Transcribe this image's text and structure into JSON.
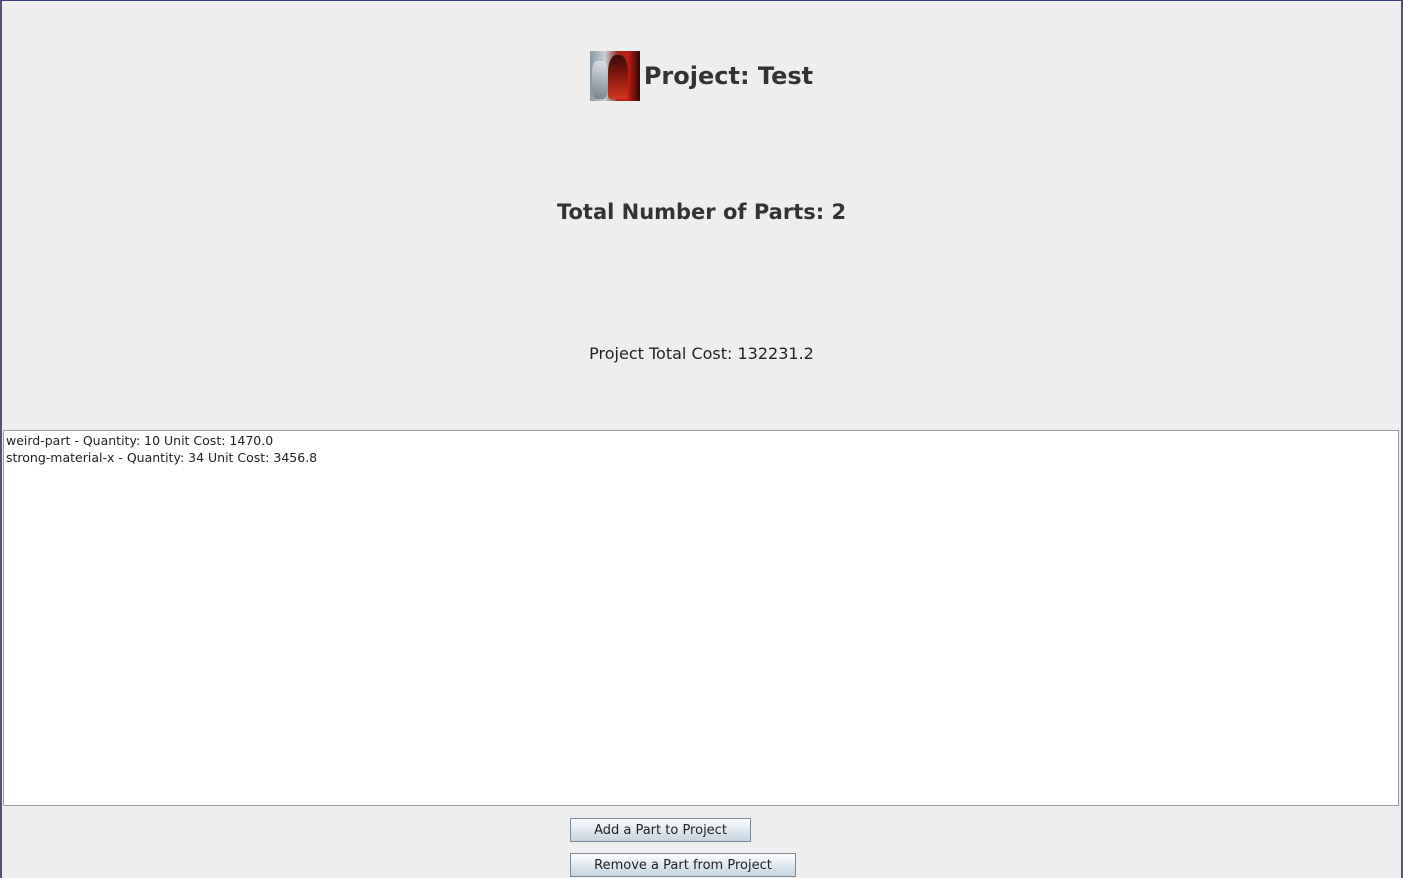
{
  "header": {
    "project_title": "Project: Test"
  },
  "summary": {
    "parts_count": "Total Number of Parts: 2",
    "total_cost": "Project Total Cost: 132231.2"
  },
  "parts": [
    "weird-part - Quantity: 10 Unit Cost: 1470.0",
    "strong-material-x - Quantity: 34 Unit Cost: 3456.8"
  ],
  "actions": {
    "add_label": "Add a Part to Project",
    "remove_label": "Remove a Part from Project"
  },
  "colors": {
    "window_bg": "#eeeeee",
    "button_border": "#7a8a99"
  },
  "icons": {
    "project": "project-image-icon"
  }
}
